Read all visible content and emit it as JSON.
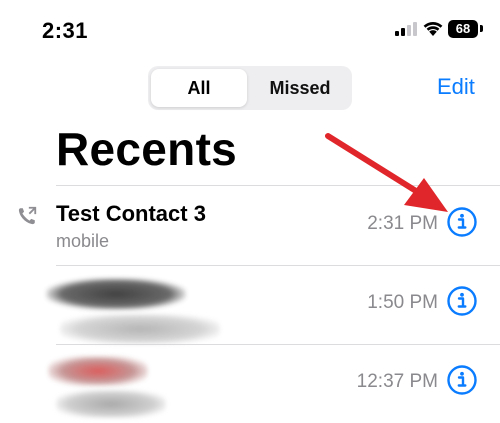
{
  "status_bar": {
    "time": "2:31",
    "battery": "68"
  },
  "filter": {
    "all_label": "All",
    "missed_label": "Missed",
    "selected": "All"
  },
  "toolbar": {
    "edit_label": "Edit"
  },
  "page": {
    "title": "Recents"
  },
  "calls": [
    {
      "name": "Test Contact 3",
      "type": "mobile",
      "time": "2:31 PM",
      "call_icon": "outgoing-call-icon",
      "info_icon": "info-icon"
    },
    {
      "name": "",
      "type": "",
      "time": "1:50 PM",
      "info_icon": "info-icon"
    },
    {
      "name": "",
      "type": "",
      "time": "12:37 PM",
      "info_icon": "info-icon"
    }
  ],
  "colors": {
    "accent": "#0a7cff",
    "secondary_text": "#8a8a8e",
    "annotation_arrow": "#e0262a"
  }
}
